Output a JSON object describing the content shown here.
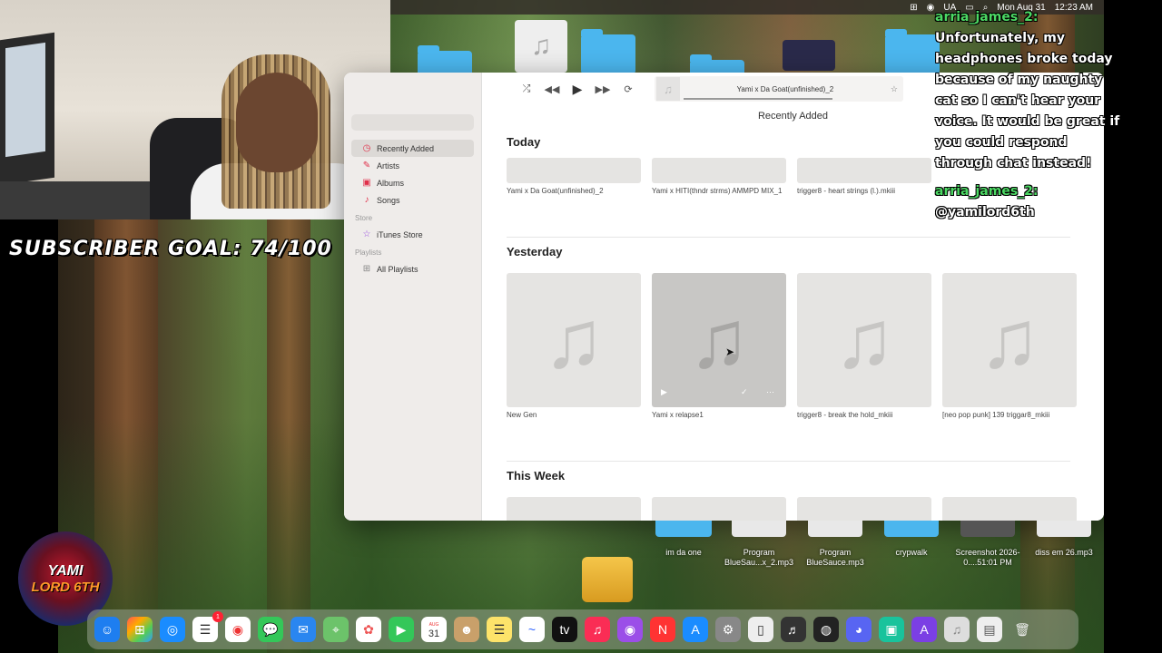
{
  "menubar": {
    "items": [
      "UA",
      "Mon Aug 31",
      "12:23 AM"
    ]
  },
  "desktop_bottom": [
    {
      "label": "im da one",
      "color": "#4bb6ee"
    },
    {
      "label": "Program BlueSau...x_2.mp3",
      "color": "#e8e8e8"
    },
    {
      "label": "Program BlueSauce.mp3",
      "color": "#e8e8e8"
    },
    {
      "label": "crypwalk",
      "color": "#4bb6ee"
    },
    {
      "label": "Screenshot 2026-0....51:01 PM",
      "color": "#555"
    },
    {
      "label": "diss em 26.mp3",
      "color": "#e8e8e8"
    }
  ],
  "overlay": {
    "subscriber_goal": "SUBSCRIBER GOAL: 74/100"
  },
  "logo": {
    "line1": "YAMI",
    "line2": "LORD 6TH"
  },
  "chat": [
    {
      "user": "arria_james_2:",
      "message": "Unfortunately, my headphones broke today because of my naughty cat so I can't hear your voice. It would be great if you could respond through chat instead!"
    },
    {
      "user": "arria_james_2:",
      "message": "@yamilord6th"
    }
  ],
  "music": {
    "now_playing": "Yami x Da Goat(unfinished)_2",
    "view_title": "Recently Added",
    "sidebar": {
      "library_items": [
        "Recently Added",
        "Artists",
        "Albums",
        "Songs"
      ],
      "store_header": "Store",
      "store_items": [
        "iTunes Store"
      ],
      "playlists_header": "Playlists",
      "playlist_items": [
        "All Playlists"
      ]
    },
    "sections": [
      {
        "title": "Today",
        "items": [
          "Yami x Da Goat(unfinished)_2",
          "Yami x HITI(thndr strms) AMMPD MIX_1",
          "trigger8 - heart strings (l.).mkiii"
        ]
      },
      {
        "title": "Yesterday",
        "items": [
          "New Gen",
          "Yami x relapse1",
          "trigger8 - break the hold_mkiii",
          "[neo pop punk] 139 triggar8_mkiii"
        ]
      },
      {
        "title": "This Week",
        "items": []
      }
    ]
  },
  "colors": {
    "accent": "#e0304a",
    "chat_user": "#4cd964",
    "folder": "#4bb6ee"
  },
  "dock": {
    "calendar_month": "AUG",
    "calendar_day": "31",
    "reminders_badge": "1"
  }
}
